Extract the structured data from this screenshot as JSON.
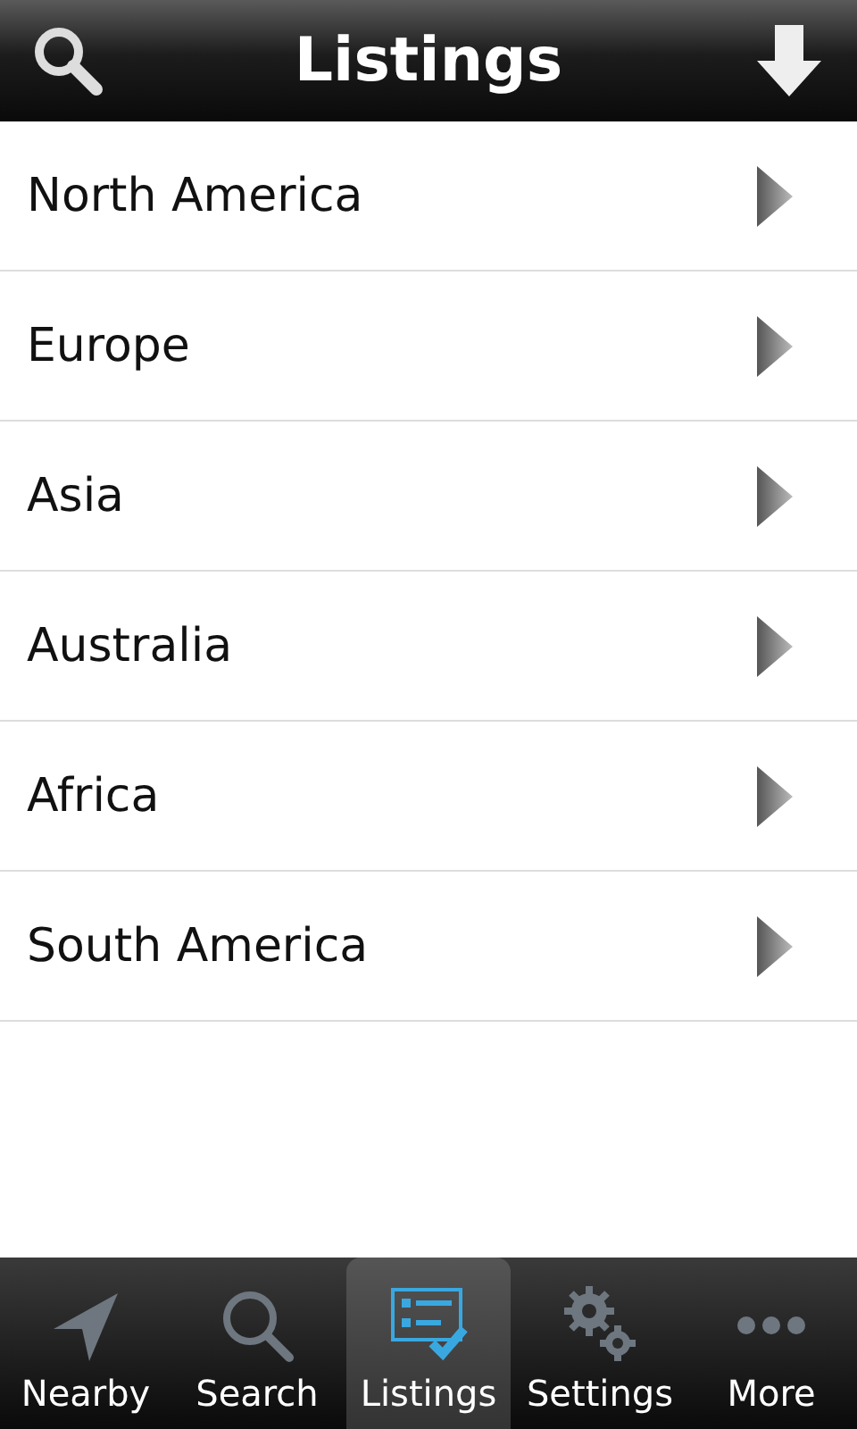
{
  "header": {
    "title": "Listings"
  },
  "regions": [
    {
      "label": "North America"
    },
    {
      "label": "Europe"
    },
    {
      "label": "Asia"
    },
    {
      "label": "Australia"
    },
    {
      "label": "Africa"
    },
    {
      "label": "South America"
    }
  ],
  "tabs": [
    {
      "label": "Nearby",
      "kind": "nearby",
      "selected": false
    },
    {
      "label": "Search",
      "kind": "search",
      "selected": false
    },
    {
      "label": "Listings",
      "kind": "listings",
      "selected": true
    },
    {
      "label": "Settings",
      "kind": "settings",
      "selected": false
    },
    {
      "label": "More",
      "kind": "more",
      "selected": false
    }
  ]
}
